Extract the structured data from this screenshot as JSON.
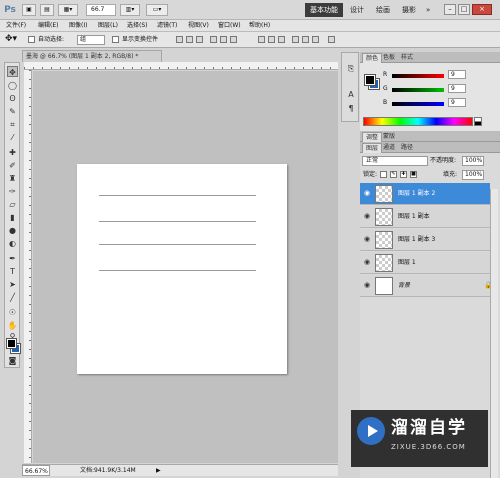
{
  "titlebar": {
    "logo": "Ps",
    "zoom": "66.7",
    "workspaces": [
      "基本功能",
      "设计",
      "绘画",
      "摄影"
    ],
    "window_buttons": [
      "–",
      "□",
      "×"
    ]
  },
  "menu": [
    "文件(F)",
    "编辑(E)",
    "图像(I)",
    "图层(L)",
    "选择(S)",
    "滤镜(T)",
    "视图(V)",
    "窗口(W)",
    "帮助(H)"
  ],
  "options": {
    "auto_select_label": "自动选择:",
    "auto_select_value": "组",
    "show_transform_label": "显示变换控件"
  },
  "document": {
    "tab_title": "墨海 @ 66.7% (图层 1 副本 2, RGB/8) *",
    "status_zoom": "66.67%",
    "status_doc": "文档:941.9K/3.14M"
  },
  "colors": {
    "foreground": "#000000",
    "background": "#1f62b3",
    "selected_layer": "#3d8ad8"
  },
  "color_panel": {
    "tabs": [
      "颜色",
      "色板",
      "样式"
    ],
    "channels": [
      {
        "label": "R",
        "value": "9"
      },
      {
        "label": "G",
        "value": "9"
      },
      {
        "label": "B",
        "value": "9"
      }
    ]
  },
  "adjust_panel": {
    "tabs": [
      "调整",
      "蒙版"
    ]
  },
  "layers_panel": {
    "tabs": [
      "图层",
      "通道",
      "路径"
    ],
    "blend_mode": "正常",
    "opacity_label": "不透明度:",
    "opacity_value": "100%",
    "lock_label": "锁定:",
    "fill_label": "填充:",
    "fill_value": "100%",
    "layers": [
      {
        "name": "图层 1 副本 2",
        "selected": true
      },
      {
        "name": "图层 1 副本",
        "selected": false
      },
      {
        "name": "图层 1 副本 3",
        "selected": false
      },
      {
        "name": "图层 1",
        "selected": false
      },
      {
        "name": "背景",
        "selected": false
      }
    ]
  },
  "watermark": {
    "title": "溜溜自学",
    "subtitle": "ZIXUE.3D66.COM"
  }
}
